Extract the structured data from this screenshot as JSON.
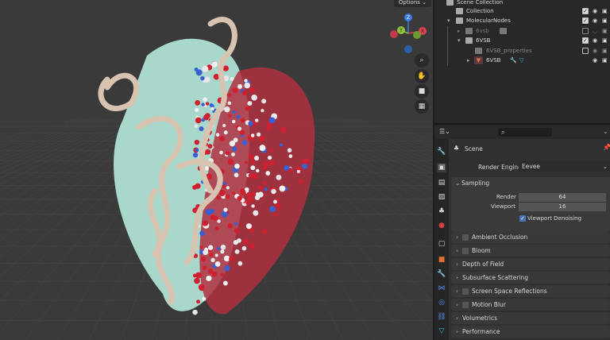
{
  "viewport": {
    "options_label": "Options ⌄",
    "gizmo": {
      "x": "X",
      "y": "Y",
      "z": "Z"
    },
    "nav_buttons": [
      {
        "name": "zoom-icon",
        "glyph": "🔍"
      },
      {
        "name": "pan-hand-icon",
        "glyph": "✋"
      },
      {
        "name": "camera-icon",
        "glyph": "🎥"
      },
      {
        "name": "ortho-grid-icon",
        "glyph": "▦"
      }
    ]
  },
  "outliner": {
    "rows": [
      {
        "label": "Scene Collection",
        "indent": 0
      },
      {
        "label": "Collection",
        "indent": 1,
        "checked": true
      },
      {
        "label": "MolecularNodes",
        "indent": 1,
        "checked": true
      },
      {
        "label": "6vsb",
        "indent": 2,
        "checked": false,
        "dim": true
      },
      {
        "label": "6VSB",
        "indent": 2,
        "checked": true
      },
      {
        "label": "6VSB_properties",
        "indent": 3,
        "checked": false,
        "dim": true
      },
      {
        "label": "6VSB",
        "indent": 3,
        "object": true
      }
    ]
  },
  "properties": {
    "search_placeholder": "",
    "context": "Scene",
    "render_engine_label": "Render Engine",
    "render_engine_value": "Eevee",
    "sampling": {
      "title": "Sampling",
      "render_label": "Render",
      "render_value": "64",
      "viewport_label": "Viewport",
      "viewport_value": "16",
      "denoise_label": "Viewport Denoising",
      "denoise_checked": true
    },
    "subpanels": [
      {
        "label": "Ambient Occlusion",
        "checkbox": true
      },
      {
        "label": "Bloom",
        "checkbox": true
      },
      {
        "label": "Depth of Field",
        "checkbox": false
      },
      {
        "label": "Subsurface Scattering",
        "checkbox": false
      },
      {
        "label": "Screen Space Reflections",
        "checkbox": true
      },
      {
        "label": "Motion Blur",
        "checkbox": true
      },
      {
        "label": "Volumetrics",
        "checkbox": false
      },
      {
        "label": "Performance",
        "checkbox": false
      }
    ]
  },
  "colors": {
    "accent": "#4772b3",
    "viewport_bg": "#3a3a3a",
    "surface": "#a8d8cc",
    "ribbon": "#d8c3b0"
  }
}
